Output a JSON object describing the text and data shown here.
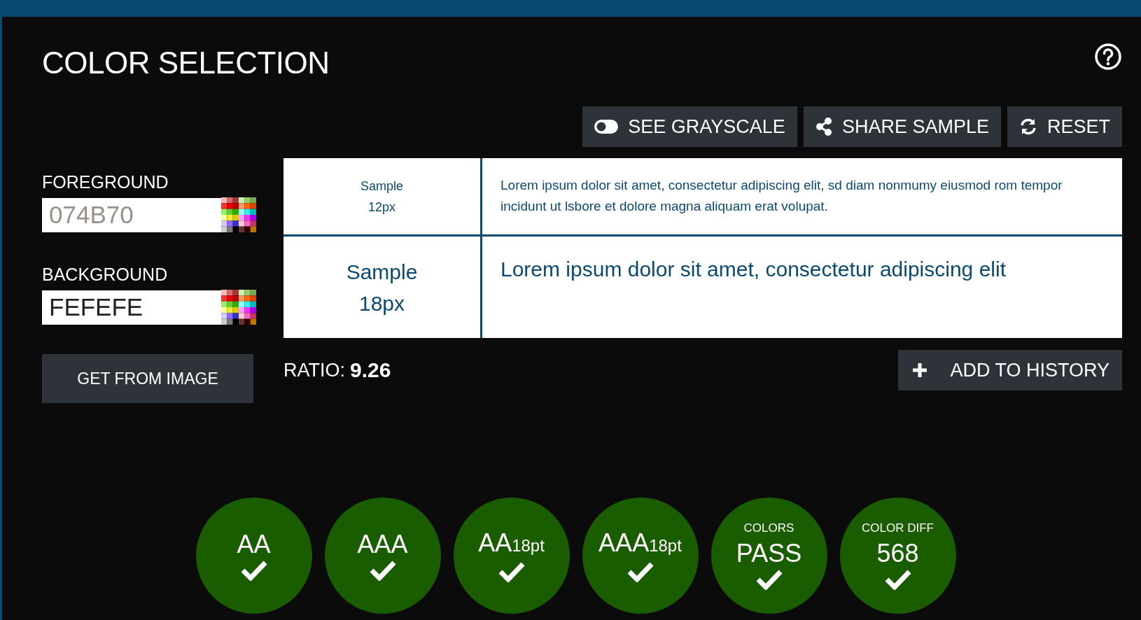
{
  "title": "COLOR SELECTION",
  "toolbar": [
    {
      "kind": "toggle",
      "label": "SEE GRAYSCALE"
    },
    {
      "kind": "share",
      "label": "SHARE SAMPLE"
    },
    {
      "kind": "reset",
      "label": "RESET"
    }
  ],
  "fields": [
    {
      "label": "FOREGROUND",
      "placeholder": "074B70"
    },
    {
      "label": "BACKGROUND",
      "value": "FEFEFE"
    }
  ],
  "get_from_image": "GET FROM IMAGE",
  "samples": [
    {
      "caption": "Sample 12px",
      "text": "Lorem ipsum dolor sit amet, consectetur adipiscing elit, sd diam nonmumy eiusmod rom tempor incidunt ut lsbore et dolore magna aliquam erat volupat.",
      "kind": "small"
    },
    {
      "caption": "Sample 18px",
      "text": "Lorem ipsum dolor sit amet, consectetur adipiscing elit",
      "kind": "large"
    }
  ],
  "ratio": {
    "label": "RATIO:",
    "value": "9.26"
  },
  "add_to_history": "ADD TO HISTORY",
  "results": [
    {
      "label": "AA",
      "passed": true
    },
    {
      "label": "AAA",
      "passed": true
    },
    {
      "label": "AA$_{18pt}$",
      "passed": true
    },
    {
      "label": "AAA$_{18pt}$",
      "passed": true
    },
    {
      "caption": "COLORS",
      "label": "PASS",
      "passed": true
    },
    {
      "caption": "COLOR DIFF",
      "label": "568",
      "passed": true
    }
  ]
}
